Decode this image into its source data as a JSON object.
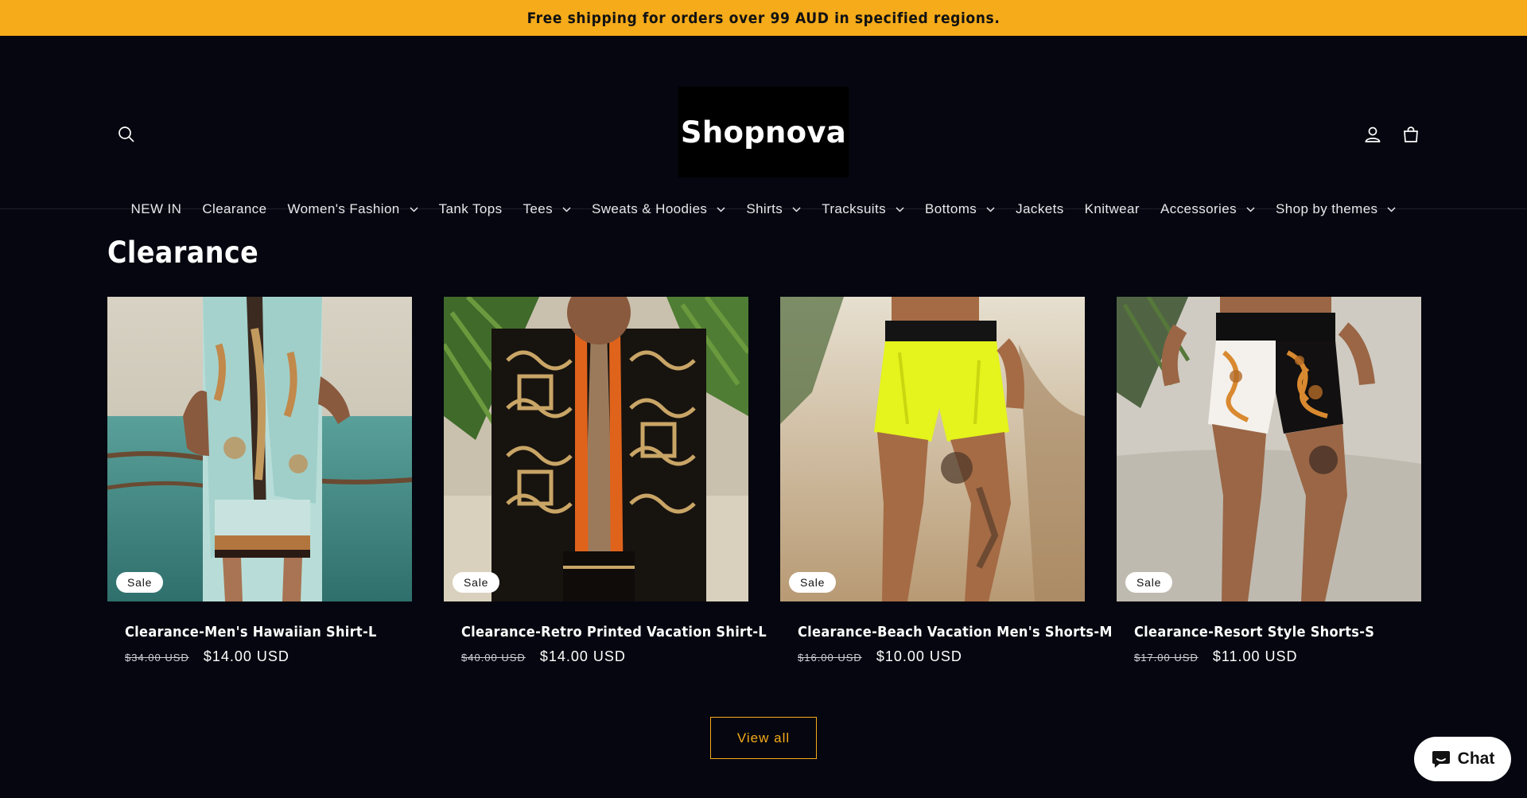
{
  "announcement": {
    "text": "Free shipping for orders over 99 AUD in specified regions."
  },
  "header": {
    "logo_text": "Shopnova",
    "search_icon": "search-icon",
    "account_icon": "account-icon",
    "cart_icon": "cart-icon"
  },
  "nav": {
    "items": [
      {
        "label": "NEW IN",
        "has_dropdown": false
      },
      {
        "label": "Clearance",
        "has_dropdown": false
      },
      {
        "label": "Women's Fashion",
        "has_dropdown": true
      },
      {
        "label": "Tank Tops",
        "has_dropdown": false
      },
      {
        "label": "Tees",
        "has_dropdown": true
      },
      {
        "label": "Sweats & Hoodies",
        "has_dropdown": true
      },
      {
        "label": "Shirts",
        "has_dropdown": true
      },
      {
        "label": "Tracksuits",
        "has_dropdown": true
      },
      {
        "label": "Bottoms",
        "has_dropdown": true
      },
      {
        "label": "Jackets",
        "has_dropdown": false
      },
      {
        "label": "Knitwear",
        "has_dropdown": false
      },
      {
        "label": "Accessories",
        "has_dropdown": true
      },
      {
        "label": "Shop by themes",
        "has_dropdown": true
      }
    ]
  },
  "section": {
    "title": "Clearance"
  },
  "products": [
    {
      "badge": "Sale",
      "title": "Clearance-Men's Hawaiian Shirt-L",
      "old_price": "$34.00 USD",
      "price": "$14.00 USD"
    },
    {
      "badge": "Sale",
      "title": "Clearance-Retro Printed Vacation Shirt-L",
      "old_price": "$40.00 USD",
      "price": "$14.00 USD"
    },
    {
      "badge": "Sale",
      "title": "Clearance-Beach Vacation Men's Shorts-M",
      "old_price": "$16.00 USD",
      "price": "$10.00 USD"
    },
    {
      "badge": "Sale",
      "title": "Clearance-Resort Style Shorts-S",
      "old_price": "$17.00 USD",
      "price": "$11.00 USD"
    }
  ],
  "view_all": {
    "label": "View all"
  },
  "chat": {
    "label": "Chat",
    "icon": "chat-bubble-icon"
  },
  "colors": {
    "announcement_bg": "#f5ab1a",
    "page_bg": "#05060f",
    "accent": "#f5ab1a"
  }
}
